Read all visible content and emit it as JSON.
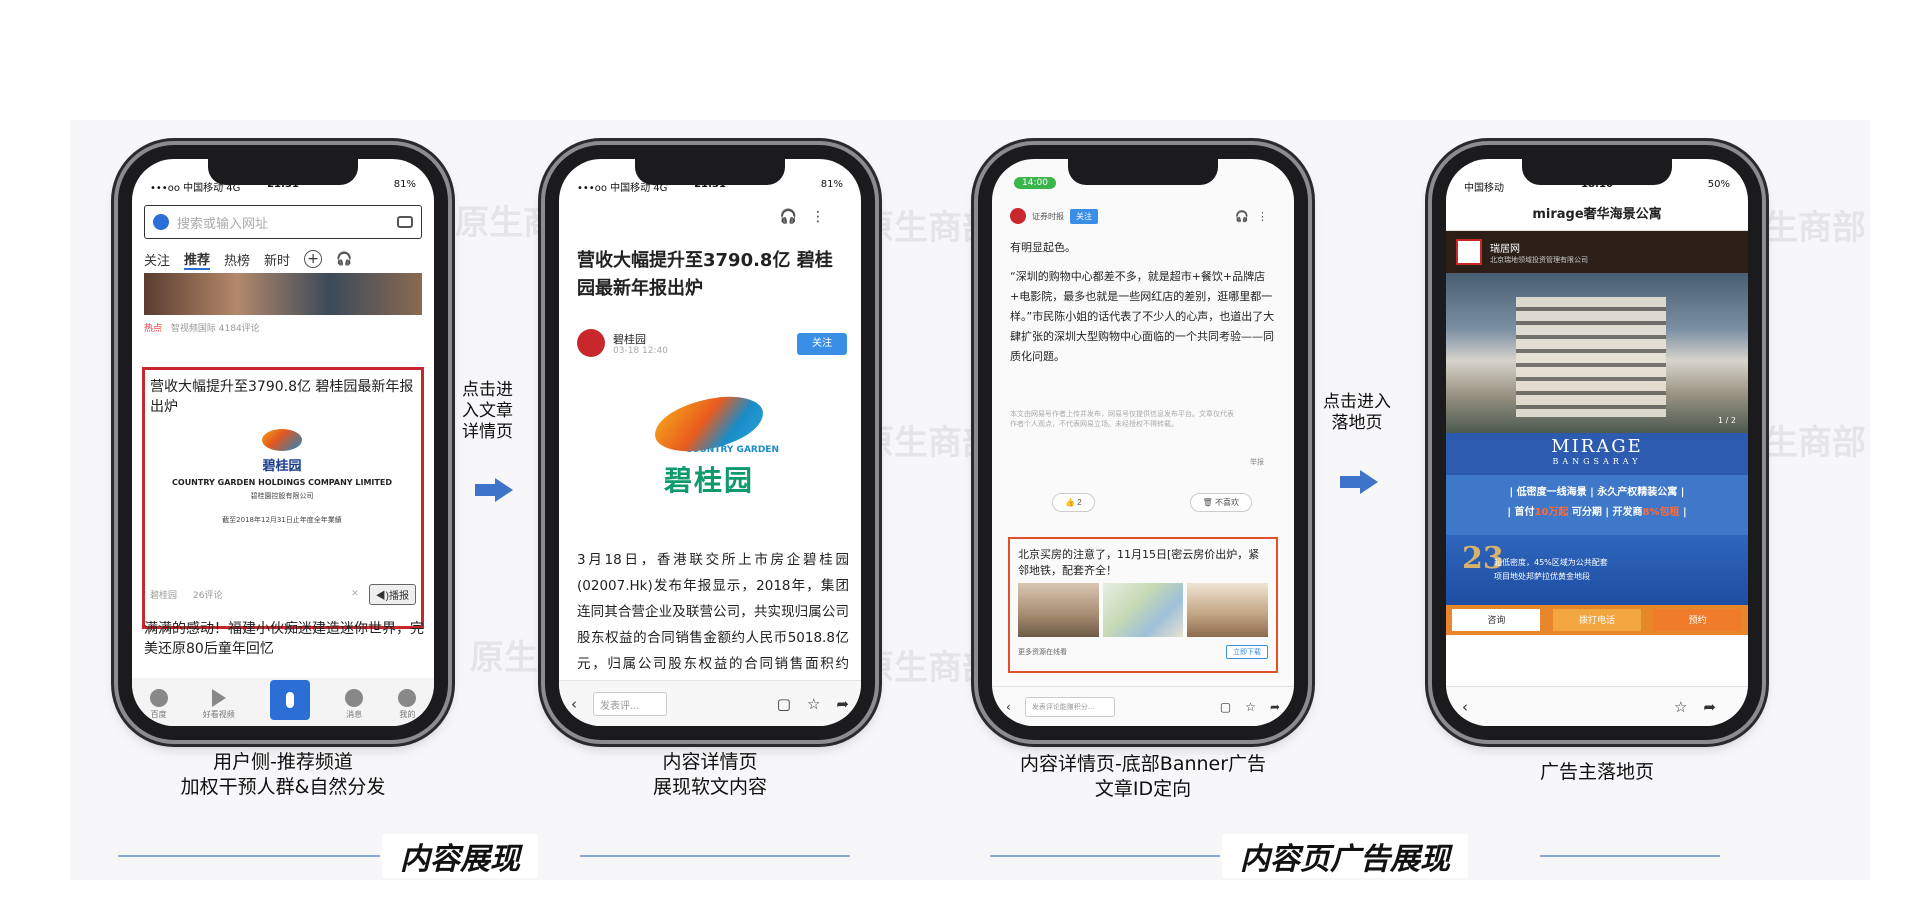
{
  "watermark": "原生商部",
  "phone1": {
    "status": {
      "carrier": "•••oo 中国移动  4G",
      "time": "21:31",
      "battery": "81%"
    },
    "search_placeholder": "搜索或输入网址",
    "tabs": [
      "关注",
      "推荐",
      "热榜",
      "新时"
    ],
    "banner_meta": {
      "hot": "热点",
      "source": "智视频国际",
      "comments": "4184评论"
    },
    "card_title": "营收大幅提升至3790.8亿 碧桂园最新年报出炉",
    "card_logo_cn": "碧桂园",
    "card_logo_en": "COUNTRY GARDEN HOLDINGS COMPANY LIMITED",
    "card_logo_cn2": "碧桂園控股有限公司",
    "card_small": "截至2018年12月31日止年度全年業績",
    "card_source": "碧桂园",
    "card_comments": "26评论",
    "play_label": "◀)播报",
    "next_title": "满满的感动！福建小伙痴迷建造迷你世界，完美还原80后童年回忆",
    "bottom_tabs": [
      "百度",
      "好看视频",
      "",
      "消息",
      "我的"
    ]
  },
  "phone2": {
    "status": {
      "carrier": "•••oo 中国移动  4G",
      "time": "21:31",
      "battery": "81%"
    },
    "title": "营收大幅提升至3790.8亿 碧桂园最新年报出炉",
    "author": "碧桂园",
    "time": "03-18 12:40",
    "follow": "关注",
    "logo_en": "COUNTRY GARDEN",
    "logo_cn": "碧桂园",
    "body": "3月18日，香港联交所上市房企碧桂园(02007.Hk)发布年报显示，2018年，集团连同其合营企业及联营公司，共实现归属公司股东权益的合同销售金额约人民币5018.8亿元，归属公司股东权益的合同销售面积约5416",
    "comment_placeholder": "发表评..."
  },
  "phone3": {
    "status_time": "14:00",
    "source": "证券时报",
    "follow": "关注",
    "text1": "有明显起色。",
    "text2": "“深圳的购物中心都差不多，就是超市+餐饮+品牌店+电影院，最多也就是一些网红店的差别，逛哪里都一样。”市民陈小姐的话代表了不少人的心声，也道出了大肆扩张的深圳大型购物中心面临的一个共同考验——同质化问题。",
    "fine_print": "本文由网易号作者上传并发布，网易号仅提供信息发布平台。文章仅代表作者个人观点，不代表网易立场。未经授权不得转载。",
    "report": "举报",
    "like": "2",
    "dislike": "不喜欢",
    "ad_text": "北京买房的注意了，11月15日[密云房价出炉，紧邻地铁，配套齐全！",
    "ad_more": "更多资源在线看",
    "ad_download": "立即下载",
    "comment_placeholder": "发表评论能赚积分..."
  },
  "phone4": {
    "status": {
      "carrier": "中国移动",
      "time": "18:10",
      "battery": "50%"
    },
    "title": "mirage奢华海景公寓",
    "brand": "瑞居网",
    "brand_sub": "北京瑞地领域投资管理有限公司",
    "page_indicator": "1 / 2",
    "mirage": "MIRAGE",
    "bangsaray": "BANGSARAY",
    "feature1_a": "| 低密度一线海景 | ",
    "feature1_b": "永久产权精装公寓 |",
    "feature2_a": "| 首付",
    "feature2_hl1": "10万起",
    "feature2_b": " 可分期 | 开发商",
    "feature2_hl2": "8%包租",
    "feature2_c": " |",
    "promo_num": "23",
    "promo_line1": "超低密度，45%区域为公共配套",
    "promo_line2": "项目地处邦萨拉优黄金地段",
    "cta": [
      "咨询",
      "拨打电话",
      "预约"
    ]
  },
  "arrows": {
    "a1": "点击进入文章详情页",
    "a1_lines": [
      "点击进",
      "入文章",
      "详情页"
    ],
    "a2_lines": [
      "点击进入",
      "落地页"
    ]
  },
  "captions": {
    "c1": [
      "用户侧-推荐频道",
      "加权干预人群&自然分发"
    ],
    "c2": [
      "内容详情页",
      "展现软文内容"
    ],
    "c3": [
      "内容详情页-底部Banner广告",
      "文章ID定向"
    ],
    "c4": [
      "广告主落地页"
    ]
  },
  "sections": {
    "s1": "内容展现",
    "s2": "内容页广告展现"
  },
  "colors": {
    "highlight_red": "#c8282b",
    "arrow_blue": "#3d73c8",
    "rule_blue": "#8aa6d2"
  }
}
